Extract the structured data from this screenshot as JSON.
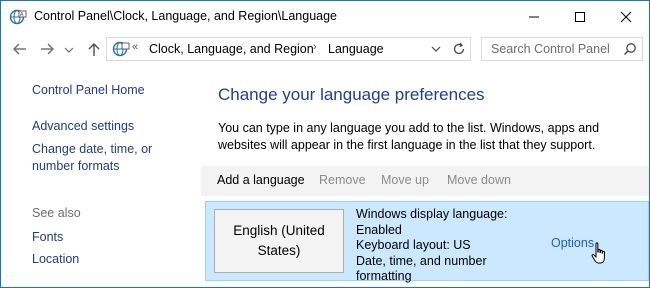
{
  "window": {
    "title": "Control Panel\\Clock, Language, and Region\\Language"
  },
  "nav": {
    "back_icon": "back-arrow-icon",
    "forward_icon": "forward-arrow-icon",
    "up_icon": "up-arrow-icon",
    "address": {
      "overflow": "«",
      "crumb1": "Clock, Language, and Region",
      "separator": "›",
      "crumb2": "Language"
    },
    "search_placeholder": "Search Control Panel"
  },
  "sidebar": {
    "home": "Control Panel Home",
    "advanced": "Advanced settings",
    "date_formats": "Change date, time, or number formats",
    "see_also": "See also",
    "fonts": "Fonts",
    "location": "Location"
  },
  "main": {
    "title": "Change your language preferences",
    "description": "You can type in any language you add to the list. Windows, apps and websites will appear in the first language in the list that they support.",
    "toolbar": {
      "add": "Add a language",
      "remove": "Remove",
      "move_up": "Move up",
      "move_down": "Move down"
    },
    "languages": [
      {
        "name": "English (United States)",
        "info_line1": "Windows display language:",
        "info_line2": "Enabled",
        "info_line3": "Keyboard layout: US",
        "info_line4": "Date, time, and number",
        "info_line5": "formatting",
        "options": "Options"
      }
    ]
  },
  "colors": {
    "accent_border": "#1e73be",
    "link": "#1f3c88",
    "heading": "#1e3e99",
    "selected_row": "#cce8ff",
    "disabled_text": "#8c8c8c"
  }
}
